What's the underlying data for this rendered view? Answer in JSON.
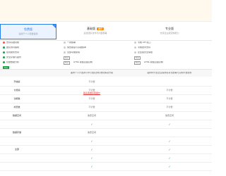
{
  "banner": {
    "title": "",
    "subtitle": ""
  },
  "plans": [
    {
      "name": "免费版",
      "desc": "适用于个人轻量使用"
    },
    {
      "name": "基础版",
      "badge": "推荐",
      "desc": "适合团队协作与内部部署"
    },
    {
      "name": "专业版",
      "desc": "支持企业级定制能力"
    }
  ],
  "features": {
    "free": [
      "支持基础功能",
      "团队协同编辑",
      "在线服务支持",
      "安全存储与备份",
      "轻量数据分析"
    ],
    "free_tag": "Free",
    "basic": [
      "一键部署",
      "免费额度与基础版本",
      "全部功能模块",
      "Free",
      "HTML 模板自由定制"
    ],
    "pro": [
      "专属 API 接口",
      "专属技术支持",
      "企业级安全保障",
      "Free",
      "HTML 模板自由定制"
    ]
  },
  "intro_row": {
    "c2": "面向个人开发者与中小团队的标准化解决方案",
    "c3": "面向中大型企业提供私有化部署与定制开发服务"
  },
  "compare_rows": [
    {
      "label": "开始版",
      "c2": "不计费",
      "c3": ""
    },
    {
      "label": "付费版",
      "c2": "不计费",
      "c3": "不计费"
    },
    {
      "label": "功能数",
      "c2": "不计费",
      "c3": "不计费"
    },
    {
      "label": "成员数",
      "c2": "不计费",
      "c3": "不计费"
    },
    {
      "label": "数据空间",
      "c2": "免费空间",
      "c3": "免费空间"
    },
    {
      "label": "",
      "c2": "✓",
      "c3": "✓"
    },
    {
      "label": "数据存储",
      "c2": "免费空间",
      "c3": ""
    },
    {
      "label": "",
      "c2": "✓",
      "c3": "✓"
    },
    {
      "label": "全部",
      "c2": "✓",
      "c3": "✓"
    },
    {
      "label": "",
      "c2": "✓",
      "c3": "✓"
    },
    {
      "label": "",
      "c2": "✓",
      "c3": "✓"
    }
  ],
  "link_text": "联系客服获取报价"
}
